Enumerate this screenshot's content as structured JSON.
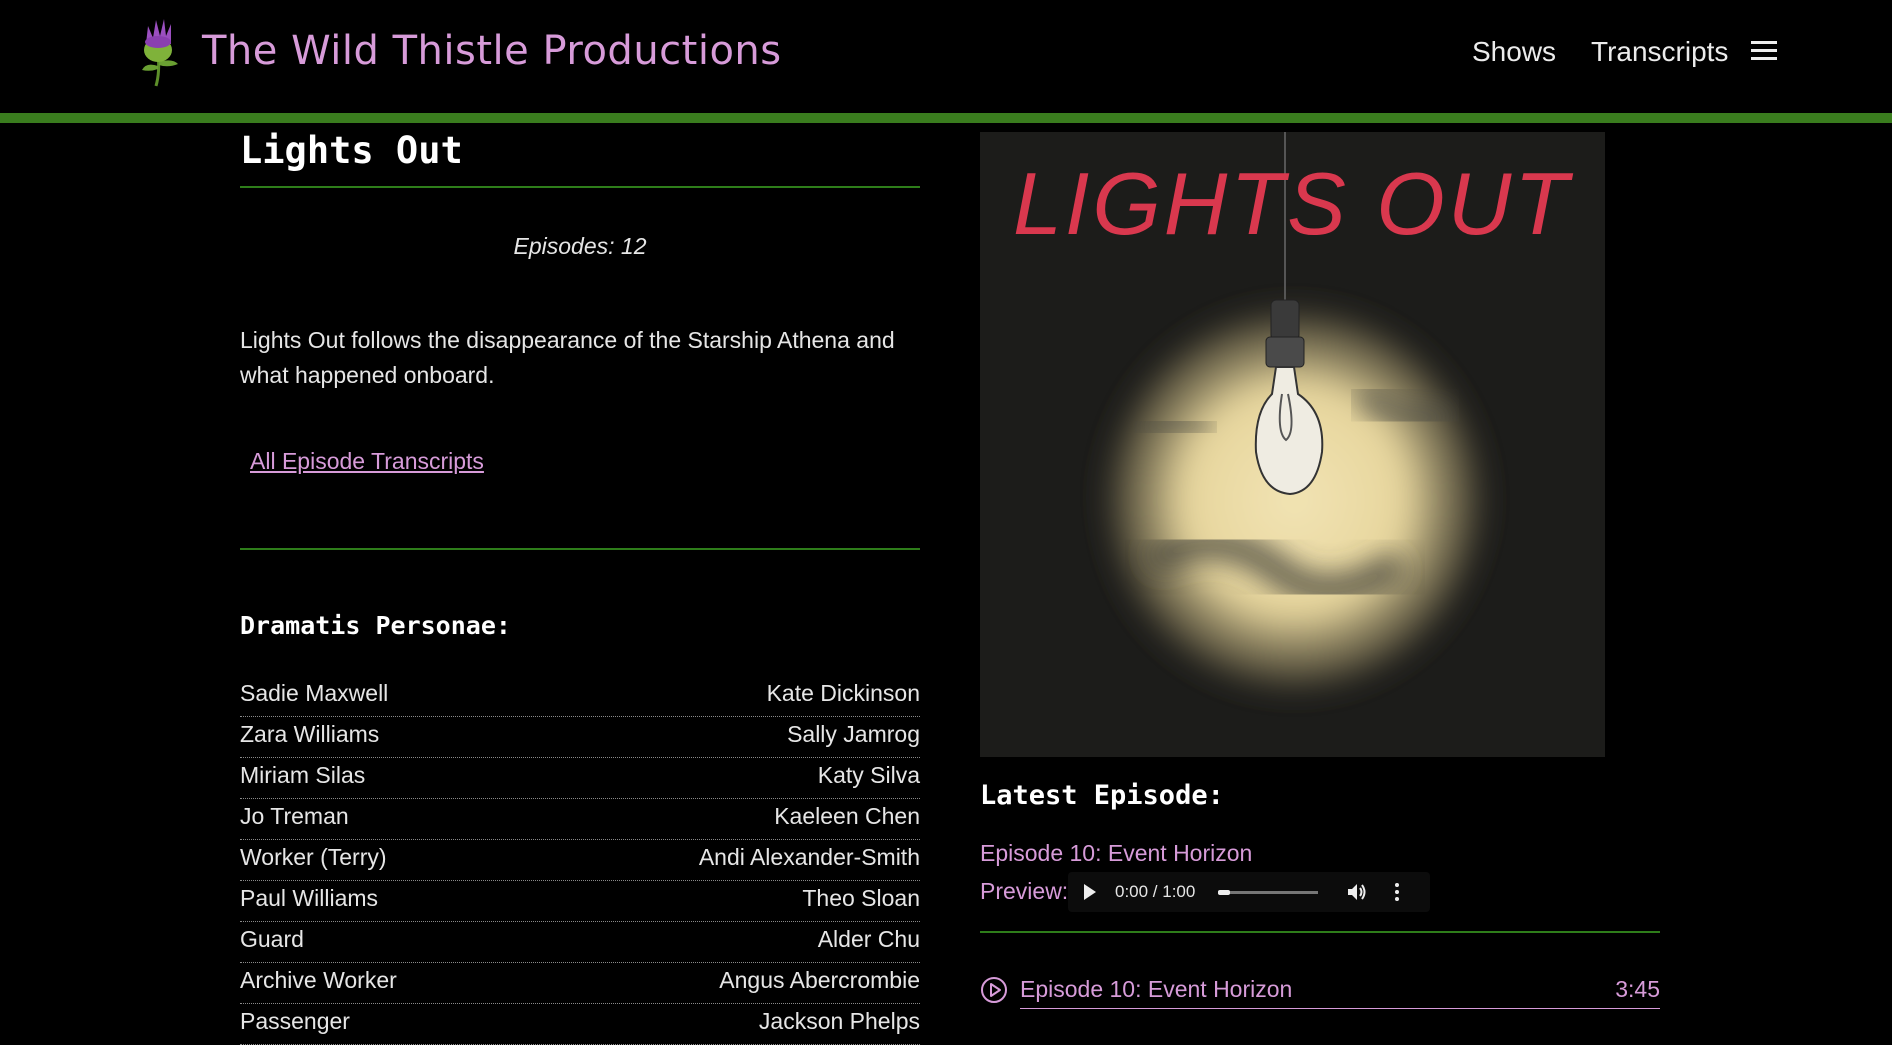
{
  "site": {
    "title": "The Wild Thistle Productions",
    "nav": {
      "shows": "Shows",
      "transcripts": "Transcripts"
    },
    "accent_color": "#d79bd9",
    "rule_color": "#2e7d1a"
  },
  "show": {
    "title": "Lights Out",
    "episodes_count": "Episodes: 12",
    "description": "Lights Out follows the disappearance of the Starship Athena and what happened onboard.",
    "transcripts_link": "All Episode Transcripts",
    "cover_text": "LIGHTS OUT"
  },
  "dramatis": {
    "heading": "Dramatis Personae:",
    "cast": [
      {
        "role": "Sadie Maxwell",
        "actor": "Kate Dickinson"
      },
      {
        "role": "Zara Williams",
        "actor": "Sally Jamrog"
      },
      {
        "role": "Miriam Silas",
        "actor": "Katy Silva"
      },
      {
        "role": "Jo Treman",
        "actor": "Kaeleen Chen"
      },
      {
        "role": "Worker (Terry)",
        "actor": "Andi Alexander-Smith"
      },
      {
        "role": "Paul Williams",
        "actor": "Theo Sloan"
      },
      {
        "role": "Guard",
        "actor": "Alder Chu"
      },
      {
        "role": "Archive Worker",
        "actor": "Angus Abercrombie"
      },
      {
        "role": "Passenger",
        "actor": "Jackson Phelps"
      }
    ]
  },
  "latest": {
    "heading": "Latest Episode:",
    "episode_title": "Episode 10: Event Horizon",
    "preview_label": "Preview:",
    "player": {
      "time": "0:00 / 1:00",
      "progress": 0
    },
    "list": [
      {
        "name": "Episode 10: Event Horizon",
        "duration": "3:45"
      }
    ]
  }
}
